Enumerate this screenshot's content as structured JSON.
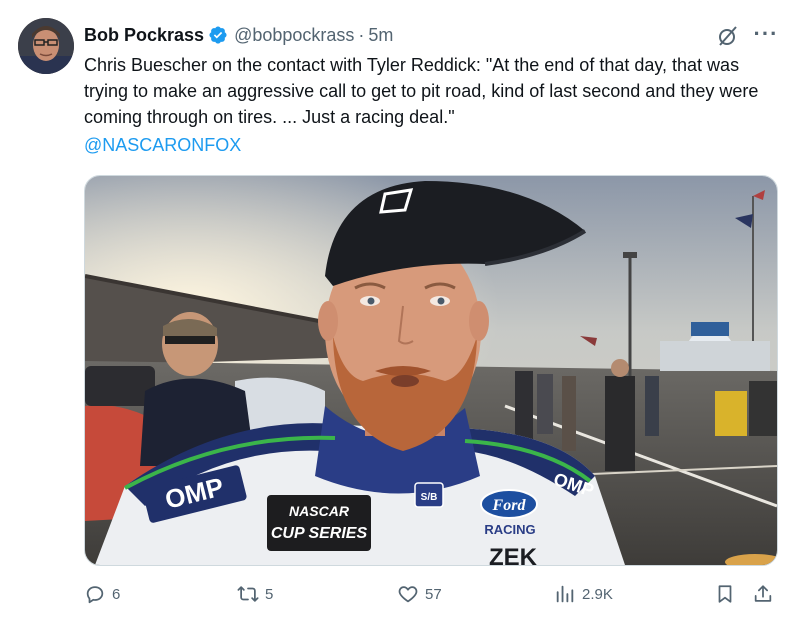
{
  "author": {
    "name": "Bob Pockrass",
    "handle": "@bobpockrass",
    "time": "5m"
  },
  "tweet": {
    "text": "Chris Buescher on the contact with Tyler Reddick: \"At the end of that day, that was trying to make an aggressive call to get to pit road, kind of last second and they were coming through on tires. ... Just a racing deal.\"",
    "mention": "@NASCARONFOX"
  },
  "media": {
    "cap_logo": "NASCAR CUP SERIES",
    "suit_text_left": "OMP",
    "suit_text_right": "OMP",
    "ford_text": "Ford",
    "racing_text": "RACING",
    "sponsor_text": "ZEK",
    "cup_line1": "NASCAR",
    "cup_line2": "CUP SERIES",
    "badge": "S/B"
  },
  "actions": {
    "replies": "6",
    "reposts": "5",
    "likes": "57",
    "views": "2.9K"
  },
  "colors": {
    "link": "#1d9bf0",
    "verified": "#1d9bf0",
    "muted": "#536471"
  }
}
